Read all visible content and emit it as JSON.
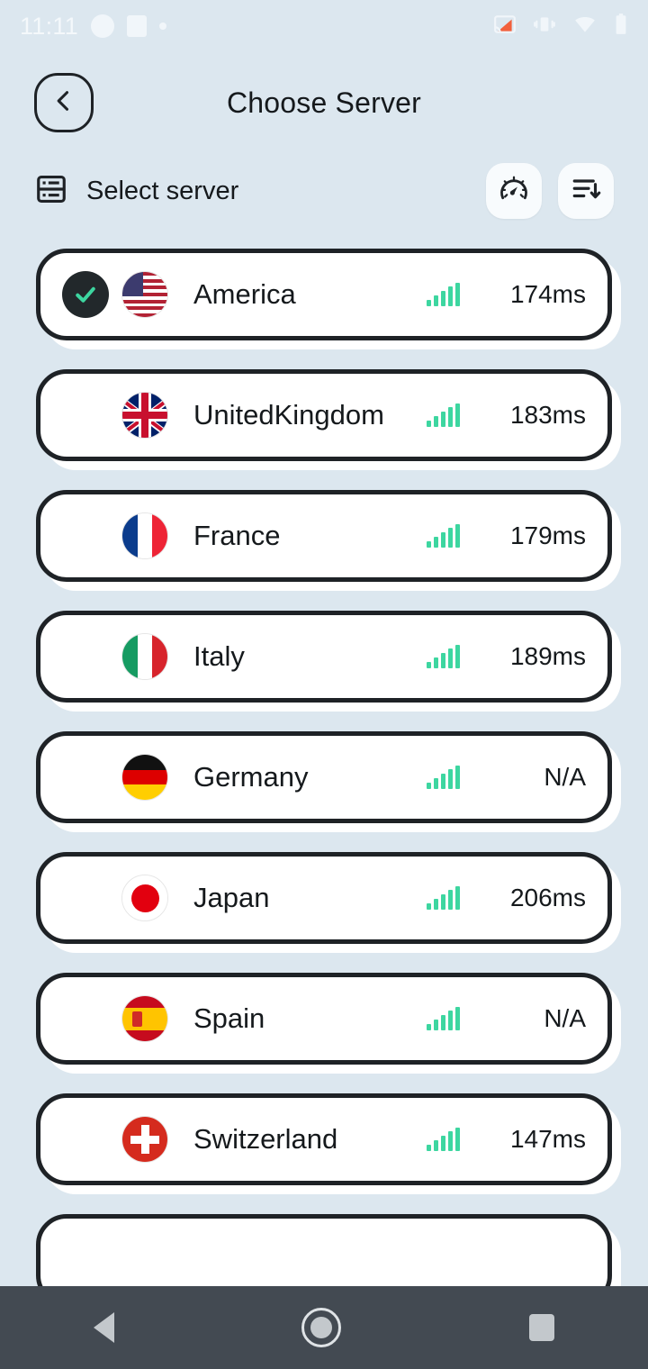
{
  "status_bar": {
    "time": "11:11",
    "left_icons": [
      "notification-circle-icon",
      "notification-square-icon",
      "notification-dot-icon"
    ],
    "right_icons": [
      "cast-icon",
      "vibrate-icon",
      "wifi-icon",
      "battery-icon"
    ],
    "cast_color": "#f2603c"
  },
  "header": {
    "back_icon": "chevron-left-icon",
    "title": "Choose Server"
  },
  "subheader": {
    "server_icon": "server-rack-icon",
    "label": "Select server",
    "ping_test_icon": "speedometer-icon",
    "sort_icon": "sort-descending-icon"
  },
  "theme": {
    "background": "#dce7ef",
    "card_background": "#ffffff",
    "card_border": "#1e2226",
    "accent_green": "#3dd6a0",
    "text": "#15191c",
    "navbar": "#434a52"
  },
  "servers": [
    {
      "name": "America",
      "ping": "174ms",
      "selected": true,
      "flag": "us",
      "signal_bars": 5
    },
    {
      "name": "UnitedKingdom",
      "ping": "183ms",
      "selected": false,
      "flag": "uk",
      "signal_bars": 5
    },
    {
      "name": "France",
      "ping": "179ms",
      "selected": false,
      "flag": "fr",
      "signal_bars": 5
    },
    {
      "name": "Italy",
      "ping": "189ms",
      "selected": false,
      "flag": "it",
      "signal_bars": 5
    },
    {
      "name": "Germany",
      "ping": "N/A",
      "selected": false,
      "flag": "de",
      "signal_bars": 5
    },
    {
      "name": "Japan",
      "ping": "206ms",
      "selected": false,
      "flag": "jp",
      "signal_bars": 5
    },
    {
      "name": "Spain",
      "ping": "N/A",
      "selected": false,
      "flag": "es",
      "signal_bars": 5
    },
    {
      "name": "Switzerland",
      "ping": "147ms",
      "selected": false,
      "flag": "ch",
      "signal_bars": 5
    },
    {
      "name": "",
      "ping": "",
      "selected": false,
      "flag": "",
      "signal_bars": 0
    }
  ],
  "navbar": {
    "back_icon": "nav-back-icon",
    "home_icon": "nav-home-icon",
    "recents_icon": "nav-recents-icon"
  }
}
